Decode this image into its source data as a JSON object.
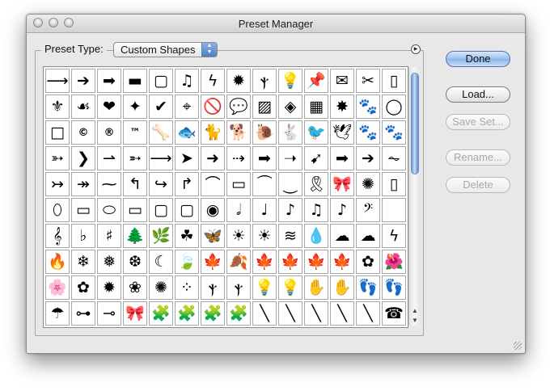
{
  "window": {
    "title": "Preset Manager"
  },
  "preset": {
    "label": "Preset Type:",
    "selected": "Custom Shapes"
  },
  "buttons": {
    "done": "Done",
    "load": "Load...",
    "save_set": "Save Set...",
    "rename": "Rename...",
    "delete": "Delete"
  },
  "shapes": [
    "⟶",
    "➔",
    "➡",
    "▬",
    "▢",
    "♫",
    "ϟ",
    "✹",
    "ⲯ",
    "💡",
    "📌",
    "✉",
    "✂",
    "▯",
    "⚜",
    "☙",
    "❤",
    "✦",
    "✔",
    "⌖",
    "🚫",
    "💬",
    "▨",
    "◈",
    "▦",
    "✸",
    "🐾",
    "◯",
    "□",
    "©",
    "®",
    "™",
    "🦴",
    "🐟",
    "🐈",
    "🐕",
    "🐌",
    "🐇",
    "🐦",
    "🕊",
    "🐾",
    "🐾",
    "➳",
    "❯",
    "⇀",
    "➵",
    "⟶",
    "➤",
    "➜",
    "⇢",
    "➡",
    "➝",
    "➹",
    "➡",
    "➔",
    "⏦",
    "↣",
    "↠",
    "⁓",
    "↰",
    "↪",
    "↱",
    "⌒",
    "▭",
    "⏜",
    "⏝",
    "🎗",
    "🎀",
    "✺",
    "▯",
    "⬯",
    "▭",
    "⬭",
    "▭",
    "▢",
    "▢",
    "◉",
    "𝅗𝅥",
    "♩",
    "♪",
    "♫",
    "♪",
    "𝄢",
    "",
    "𝄞",
    "♭",
    "♯",
    "🌲",
    "🌿",
    "☘",
    "🦋",
    "☀",
    "☀",
    "≋",
    "💧",
    "☁",
    "☁",
    "ϟ",
    "🔥",
    "❄",
    "❅",
    "❆",
    "☾",
    "🍃",
    "🍁",
    "🍂",
    "🍁",
    "🍁",
    "🍁",
    "🍁",
    "✿",
    "🌺",
    "🌸",
    "✿",
    "✹",
    "❀",
    "✺",
    "⁘",
    "ⲯ",
    "ⲯ",
    "💡",
    "💡",
    "✋",
    "✋",
    "👣",
    "👣",
    "☂",
    "⊶",
    "⊸",
    "🎀",
    "🧩",
    "🧩",
    "🧩",
    "🧩",
    "╲",
    "╲",
    "╲",
    "╲",
    "╲",
    "☎"
  ]
}
